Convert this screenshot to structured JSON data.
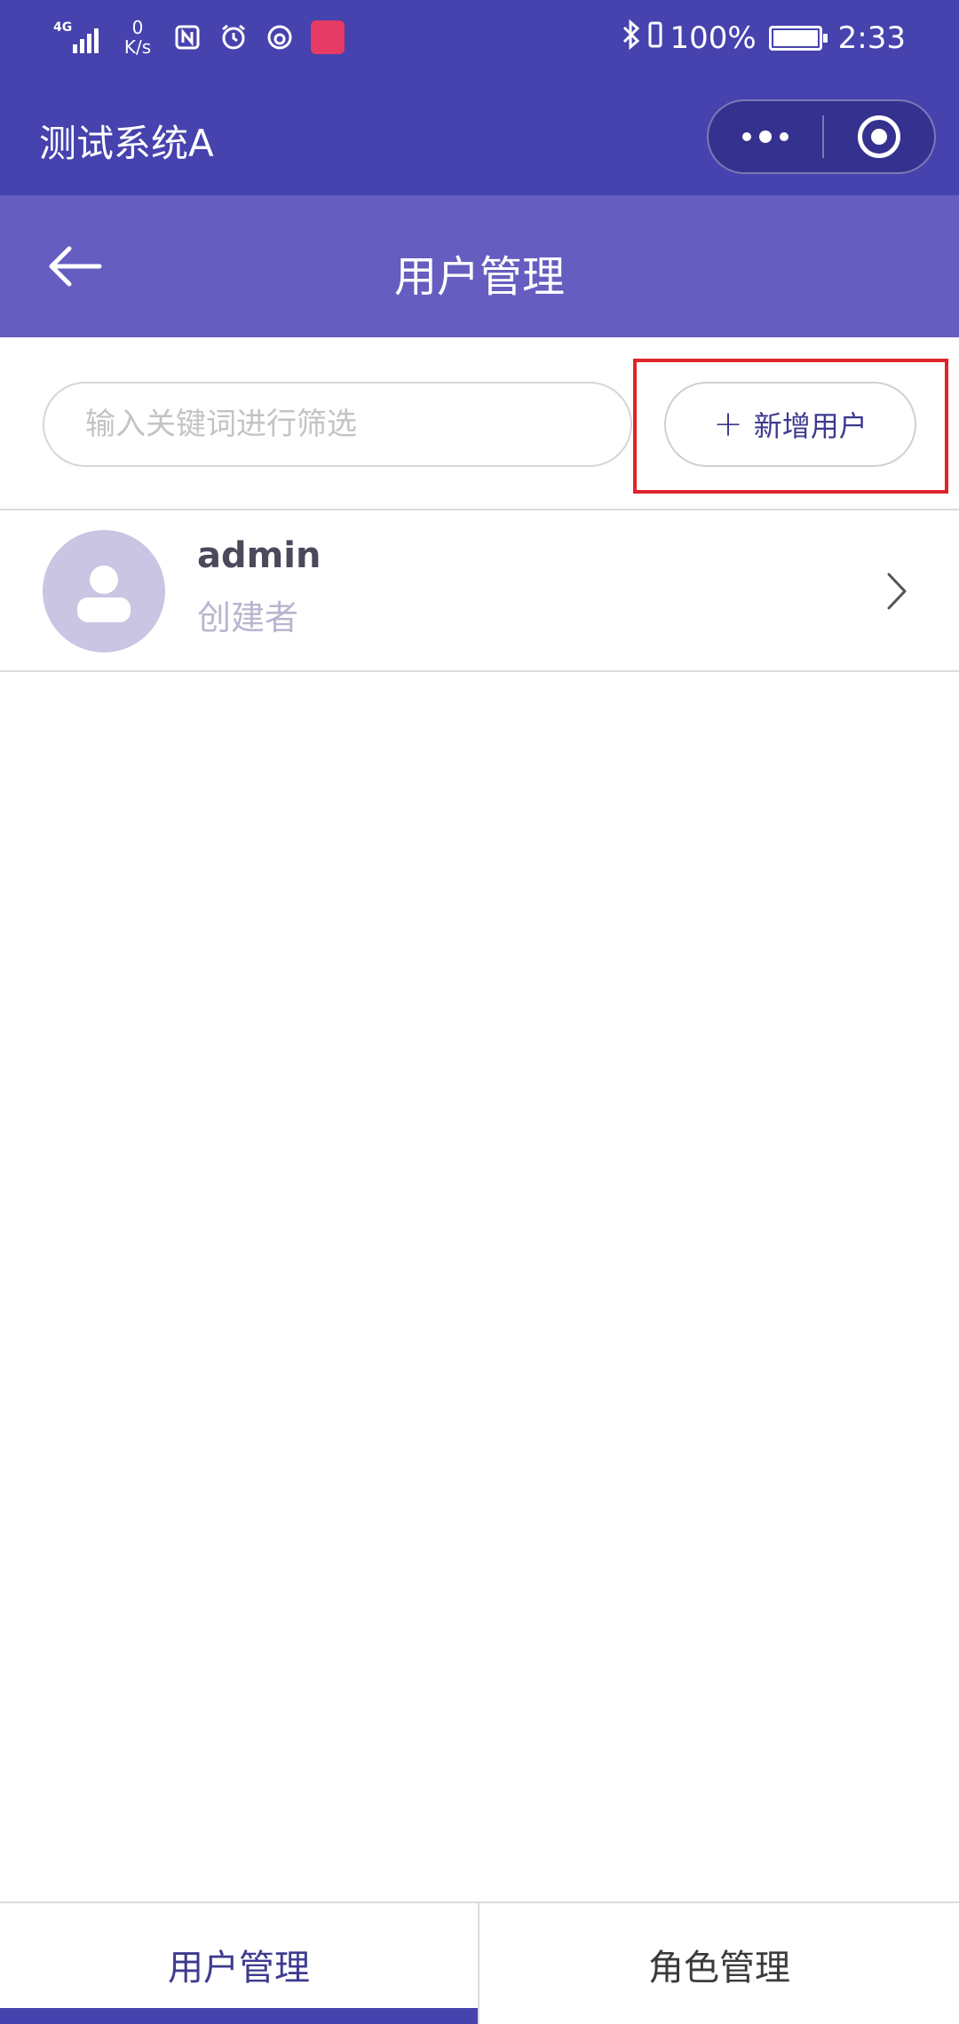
{
  "status_bar": {
    "network_type": "4G",
    "net_speed_value": "0",
    "net_speed_unit": "K/s",
    "battery_level": "100%",
    "time": "2:33",
    "icons": [
      "signal-icon",
      "nfc-icon",
      "alarm-icon",
      "netease-music-icon",
      "tmall-icon",
      "bluetooth-icon",
      "vibrate-icon",
      "battery-icon"
    ]
  },
  "app_header": {
    "title": "测试系统A"
  },
  "nav": {
    "title": "用户管理"
  },
  "toolbar": {
    "search_placeholder": "输入关键词进行筛选",
    "search_value": "",
    "add_user_label": "新增用户",
    "add_user_icon": "+"
  },
  "users": [
    {
      "name": "admin",
      "role": "创建者"
    }
  ],
  "tabs": [
    {
      "label": "用户管理",
      "active": true
    },
    {
      "label": "角色管理",
      "active": false
    }
  ],
  "colors": {
    "header_bg": "#4642ae",
    "navbar_bg": "#665dc0",
    "accent_text": "#3d3a8f",
    "avatar_bg": "#c9c5e2",
    "highlight_border": "#e0232a"
  }
}
